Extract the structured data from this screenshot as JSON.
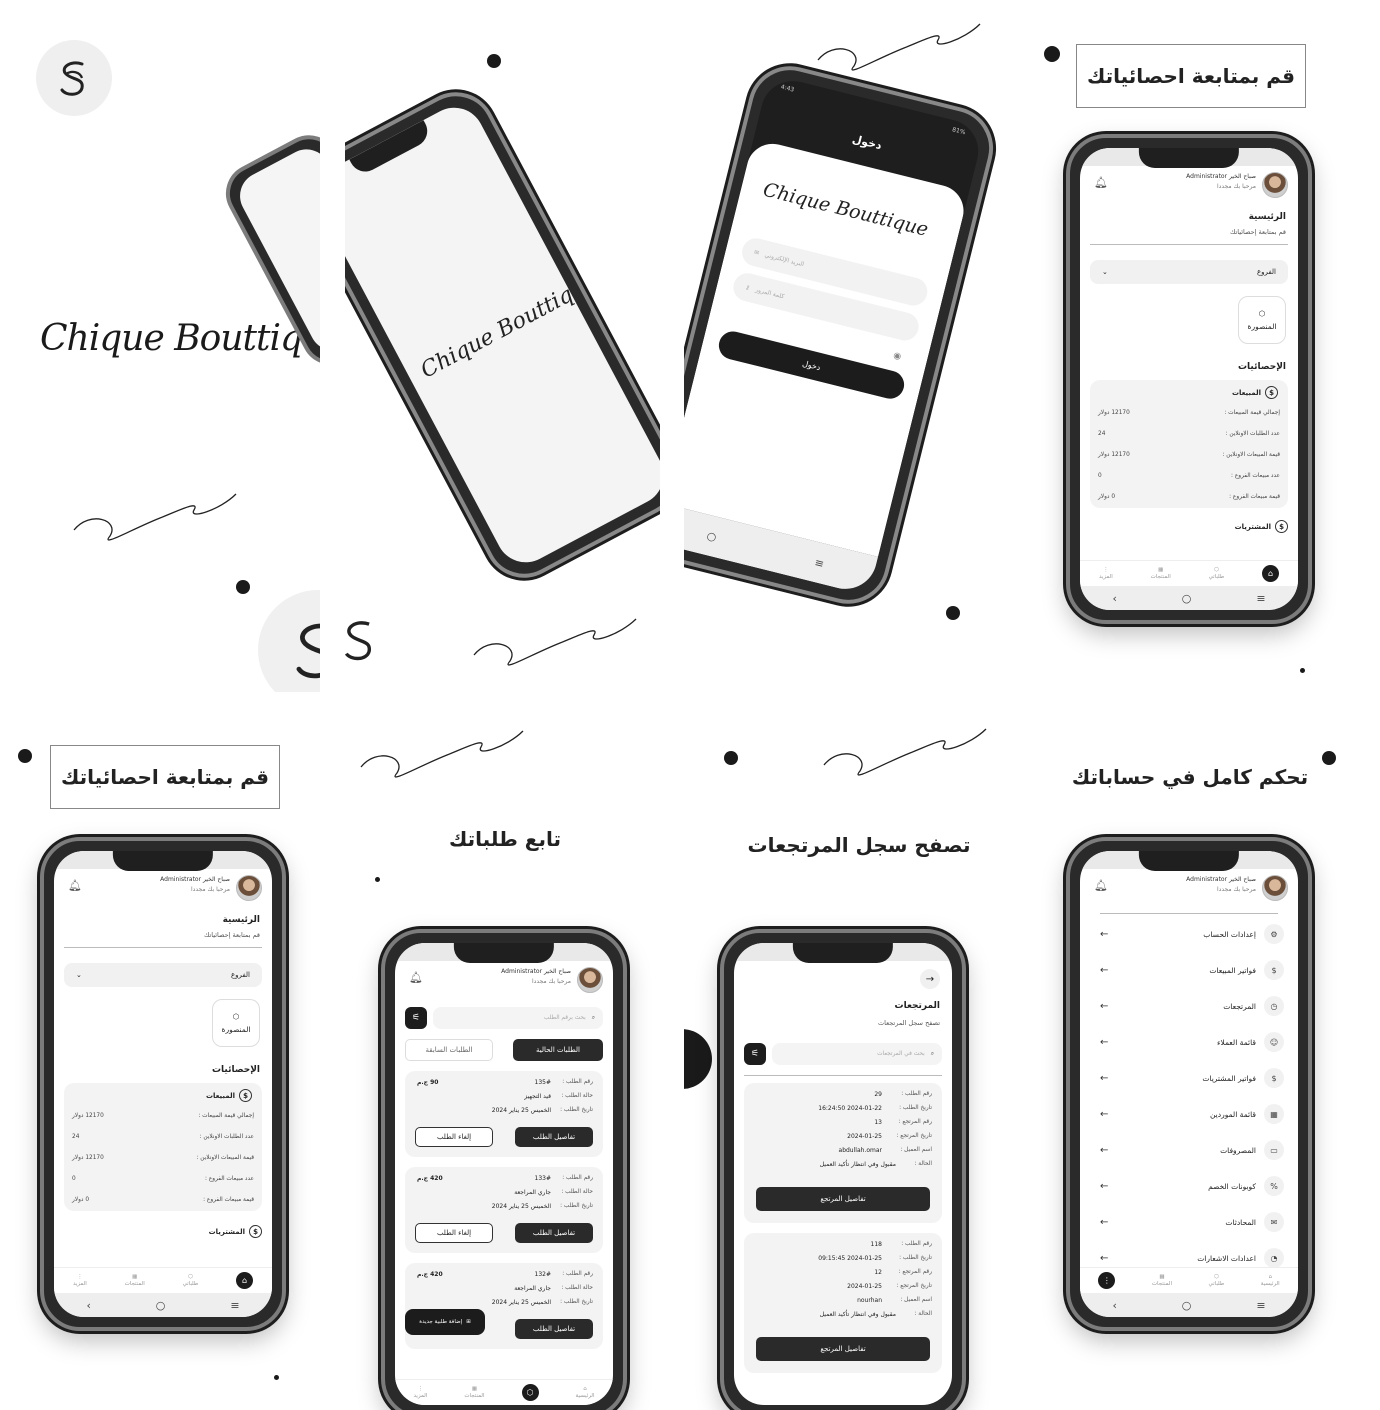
{
  "brand": {
    "name": "Chique Bouttique",
    "logo_mark": "S-leaf-logo"
  },
  "colors": {
    "background": "#ffffff",
    "primary_dark": "#1d1d1d",
    "card_bg": "#f3f3f3",
    "phone_frame": "#2a2a2a"
  },
  "captions": {
    "stats_top": "قم بمتابعة احصائياتك",
    "stats_bottom": "قم بمتابعة احصائياتك",
    "orders": "تابع طلباتك",
    "returns": "تصفح سجل المرتجعات",
    "accounts": "تحكم كامل في حساباتك"
  },
  "login": {
    "title": "دخول",
    "email_placeholder": "البريد الإلكتروني",
    "password_placeholder": "كلمة المرور",
    "submit": "دخول",
    "status_time": "4:43",
    "status_battery": "81%"
  },
  "header": {
    "user_name": "صباح الخير Administrator",
    "welcome": "مرحبا بك مجددا"
  },
  "home": {
    "title": "الرئيسية",
    "subtitle": "قم بمتابعة إحصائياتك",
    "branch_select": "الفروع",
    "branch_card": "المنصورة",
    "stats_title": "الإحصائيات",
    "sales_title": "المبيعات",
    "purchases_title": "المشتريات",
    "stats": [
      {
        "label": "إجمالي قيمة المبيعات :",
        "value": "12170 دولار"
      },
      {
        "label": "عدد الطلبات الاونلاين :",
        "value": "24"
      },
      {
        "label": "قيمة المبيعات الاونلاين :",
        "value": "12170 دولار"
      },
      {
        "label": "عدد مبيعات الفروع :",
        "value": "0"
      },
      {
        "label": "قيمة مبيعات الفروع :",
        "value": "0 دولار"
      }
    ]
  },
  "bottom_nav": {
    "more": "المزيد",
    "products": "المنتجات",
    "orders": "طلباتي",
    "home": "الرئيسية"
  },
  "orders": {
    "search_placeholder": "بحث برقم الطلب",
    "tab_current": "الطلبات الحالية",
    "tab_previous": "الطلبات السابقة",
    "label_number": "رقم الطلب :",
    "label_status": "حالة الطلب :",
    "label_date": "تاريخ الطلب :",
    "details_button": "تفاصيل الطلب",
    "cancel_button": "إلغاء الطلب",
    "add_order_button": "إضافة طلبية جديدة",
    "items": [
      {
        "number": "135#",
        "price": "90 ج.م",
        "status": "قيد التجهيز",
        "date": "الخميس 25 يناير 2024"
      },
      {
        "number": "133#",
        "price": "420 ج.م",
        "status": "جاري المراجعة",
        "date": "الخميس 25 يناير 2024"
      },
      {
        "number": "132#",
        "price": "420 ج.م",
        "status": "جاري المراجعة",
        "date": "الخميس 25 يناير 2024"
      }
    ]
  },
  "returns": {
    "title": "المرتجعات",
    "subtitle": "تصفح سجل المرتجعات",
    "search_placeholder": "بحث في المرتجعات",
    "details_button": "تفاصيل المرتجع",
    "labels": [
      "رقم الطلب :",
      "تاريخ الطلب :",
      "رقم المرتجع :",
      "تاريخ المرتجع :",
      "اسم العميل :",
      "الحالة :"
    ],
    "items": [
      {
        "values": [
          "29",
          "2024-01-22 16:24:50",
          "13",
          "2024-01-25",
          "abdullah.omar",
          "مقبول وفي انتظار تأكيد العميل"
        ]
      },
      {
        "values": [
          "118",
          "2024-01-25 09:15:45",
          "12",
          "2024-01-25",
          "nourhan",
          "مقبول وفي انتظار تأكيد العميل"
        ]
      }
    ]
  },
  "menu": {
    "items": [
      {
        "label": "إعدادات الحساب",
        "icon": "gear-icon",
        "glyph": "⚙"
      },
      {
        "label": "فواتير المبيعات",
        "icon": "dollar-icon",
        "glyph": "$"
      },
      {
        "label": "المرتجعات",
        "icon": "clock-icon",
        "glyph": "◷"
      },
      {
        "label": "قائمة العملاء",
        "icon": "users-icon",
        "glyph": "☺"
      },
      {
        "label": "فواتير المشتريات",
        "icon": "dollar-icon",
        "glyph": "$"
      },
      {
        "label": "قائمة الموردين",
        "icon": "building-icon",
        "glyph": "▦"
      },
      {
        "label": "المصروفات",
        "icon": "wallet-icon",
        "glyph": "▭"
      },
      {
        "label": "كوبونات الخصم",
        "icon": "percent-icon",
        "glyph": "%"
      },
      {
        "label": "المحادثات",
        "icon": "chat-icon",
        "glyph": "✉"
      },
      {
        "label": "اعدادات الاشعارات",
        "icon": "bell-icon",
        "glyph": "◔"
      }
    ]
  }
}
